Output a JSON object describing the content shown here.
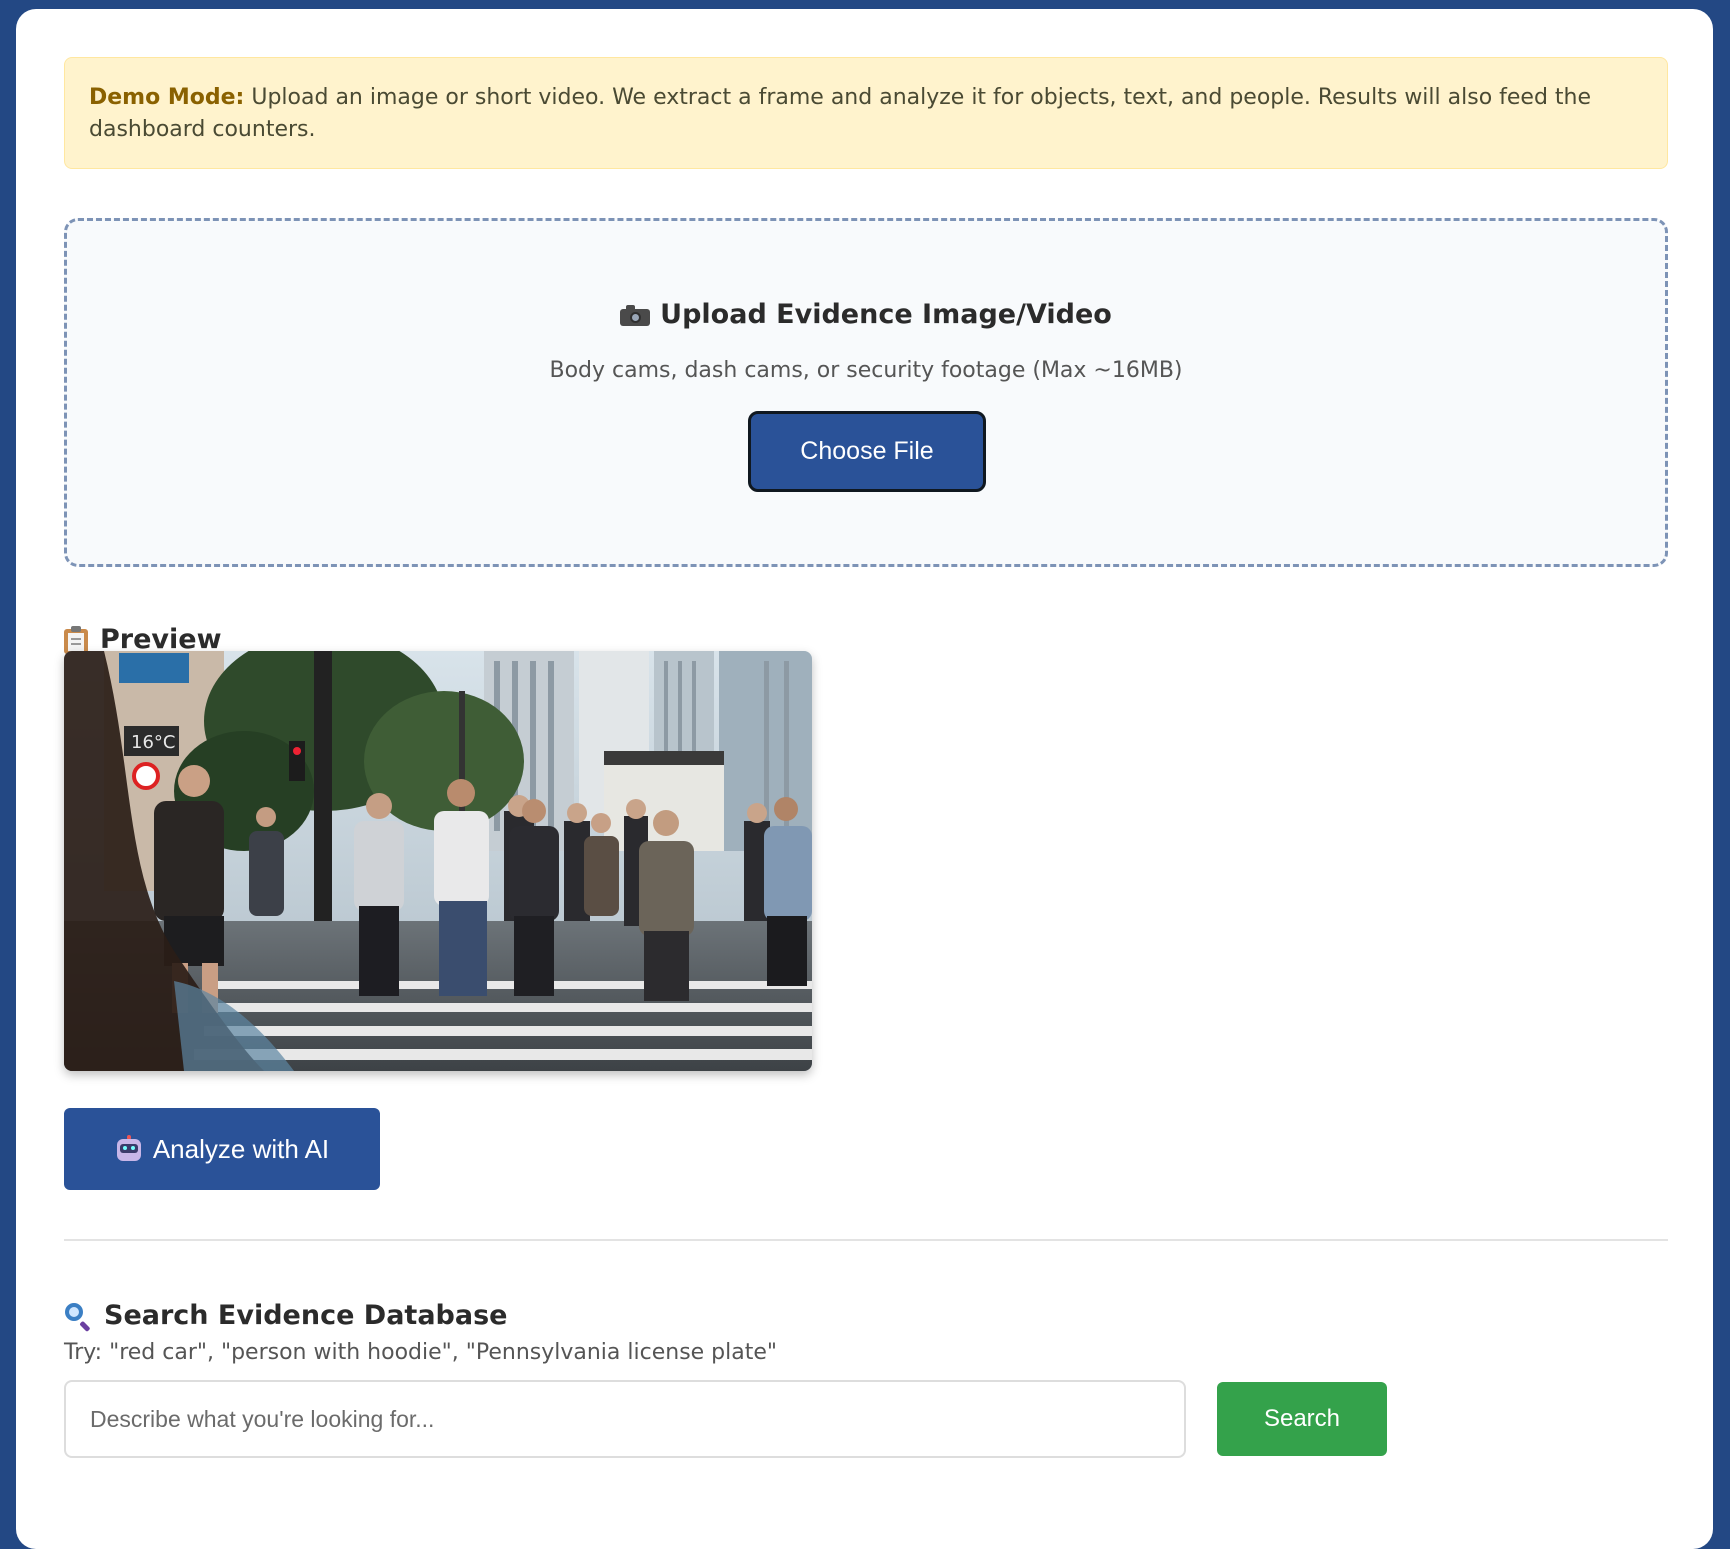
{
  "notice": {
    "label": "Demo Mode:",
    "text": "Upload an image or short video. We extract a frame and analyze it for objects, text, and people. Results will also feed the dashboard counters."
  },
  "upload": {
    "icon": "camera-icon",
    "title": "Upload Evidence Image/Video",
    "subtitle": "Body cams, dash cams, or security footage (Max ~16MB)",
    "choose_label": "Choose File"
  },
  "preview": {
    "icon": "clipboard-icon",
    "title": "Preview",
    "image_label": "16°C"
  },
  "analyze": {
    "icon": "robot-icon",
    "label": "Analyze with AI"
  },
  "search": {
    "icon": "magnifier-icon",
    "title": "Search Evidence Database",
    "hint": "Try: \"red car\", \"person with hoodie\", \"Pennsylvania license plate\"",
    "placeholder": "Describe what you're looking for...",
    "button_label": "Search"
  },
  "colors": {
    "page_bg": "#234884",
    "primary": "#2a5298",
    "search_button": "#34a24b",
    "notice_bg": "#fff3cd",
    "notice_label": "#8a6100"
  }
}
